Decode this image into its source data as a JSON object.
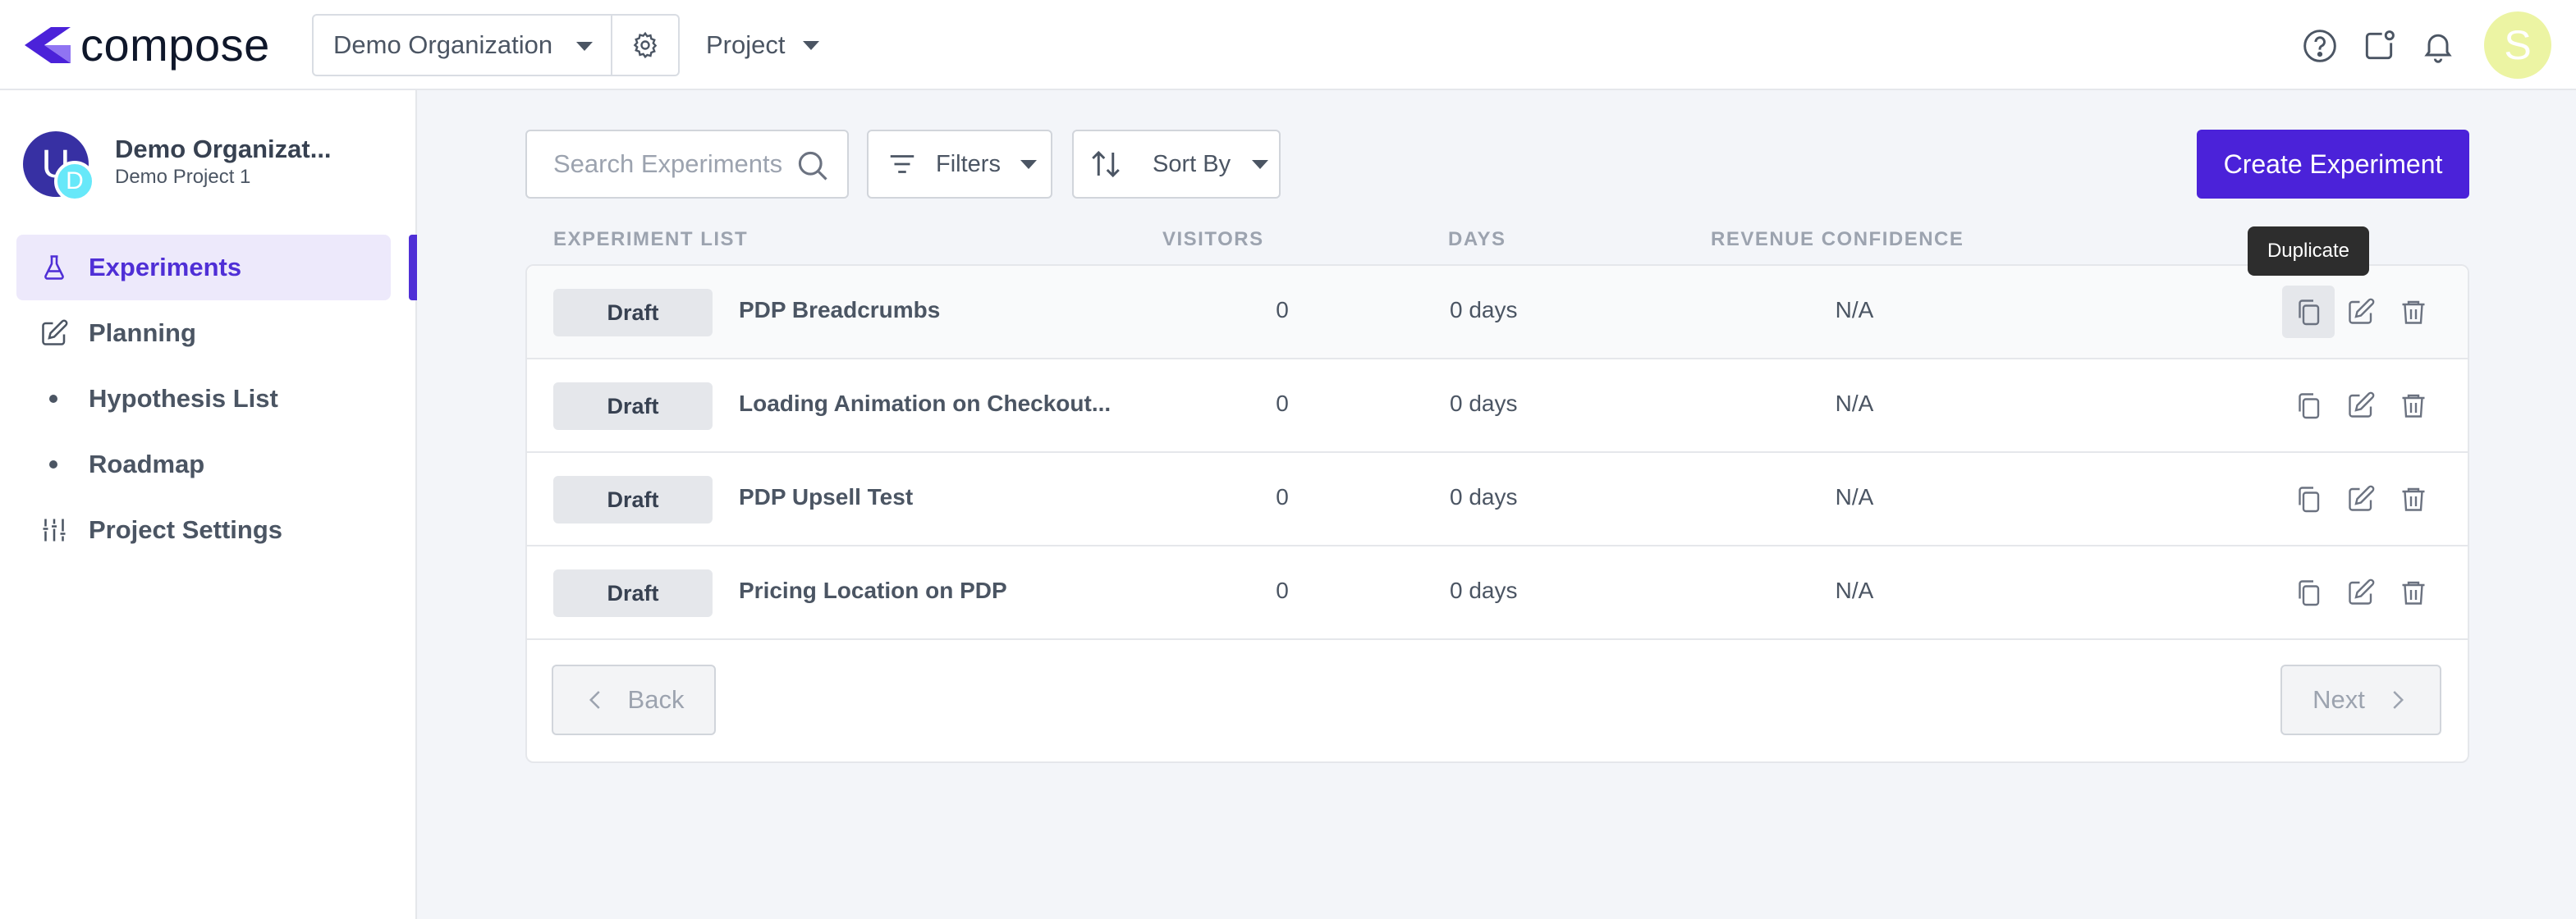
{
  "brand": {
    "name": "compose",
    "color": "#4b22d9"
  },
  "header": {
    "organization": "Demo Organization",
    "project_label": "Project"
  },
  "sidebar": {
    "project_avatar_letter": "U",
    "project_badge_letter": "D",
    "org_name": "Demo Organizat...",
    "project_name": "Demo Project 1",
    "items": [
      {
        "label": "Experiments",
        "icon": "flask-icon",
        "active": true
      },
      {
        "label": "Planning",
        "icon": "edit-icon"
      },
      {
        "label": "Hypothesis List",
        "icon": "dot"
      },
      {
        "label": "Roadmap",
        "icon": "dot"
      },
      {
        "label": "Project Settings",
        "icon": "sliders-icon"
      }
    ]
  },
  "user": {
    "avatar_letter": "S"
  },
  "toolbar": {
    "search_placeholder": "Search Experiments",
    "filters_label": "Filters",
    "sort_label": "Sort By",
    "create_label": "Create Experiment"
  },
  "table": {
    "columns": [
      "EXPERIMENT LIST",
      "VISITORS",
      "DAYS",
      "REVENUE CONFIDENCE"
    ],
    "rows": [
      {
        "status": "Draft",
        "name": "PDP Breadcrumbs",
        "visitors": "0",
        "days": "0 days",
        "confidence": "N/A"
      },
      {
        "status": "Draft",
        "name": "Loading Animation on Checkout...",
        "visitors": "0",
        "days": "0 days",
        "confidence": "N/A"
      },
      {
        "status": "Draft",
        "name": "PDP Upsell Test",
        "visitors": "0",
        "days": "0 days",
        "confidence": "N/A"
      },
      {
        "status": "Draft",
        "name": "Pricing Location on PDP",
        "visitors": "0",
        "days": "0 days",
        "confidence": "N/A"
      }
    ]
  },
  "tooltip": "Duplicate",
  "pagination": {
    "back_label": "Back",
    "next_label": "Next"
  }
}
